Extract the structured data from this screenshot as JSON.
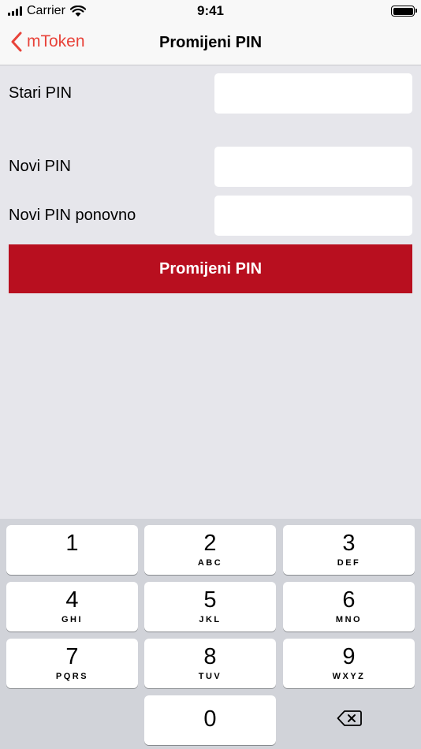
{
  "status": {
    "carrier": "Carrier",
    "time": "9:41"
  },
  "nav": {
    "back_label": "mToken",
    "title": "Promijeni PIN"
  },
  "form": {
    "old_pin_label": "Stari PIN",
    "new_pin_label": "Novi PIN",
    "confirm_pin_label": "Novi PIN ponovno",
    "old_pin_value": "",
    "new_pin_value": "",
    "confirm_pin_value": "",
    "submit_label": "Promijeni PIN"
  },
  "keypad": {
    "keys": [
      {
        "num": "1",
        "letters": ""
      },
      {
        "num": "2",
        "letters": "ABC"
      },
      {
        "num": "3",
        "letters": "DEF"
      },
      {
        "num": "4",
        "letters": "GHI"
      },
      {
        "num": "5",
        "letters": "JKL"
      },
      {
        "num": "6",
        "letters": "MNO"
      },
      {
        "num": "7",
        "letters": "PQRS"
      },
      {
        "num": "8",
        "letters": "TUV"
      },
      {
        "num": "9",
        "letters": "WXYZ"
      }
    ],
    "zero": "0"
  },
  "colors": {
    "accent": "#e8433a",
    "button": "#b80f1f"
  },
  "icons": {
    "back": "chevron-left-icon",
    "wifi": "wifi-icon",
    "delete": "backspace-icon"
  }
}
